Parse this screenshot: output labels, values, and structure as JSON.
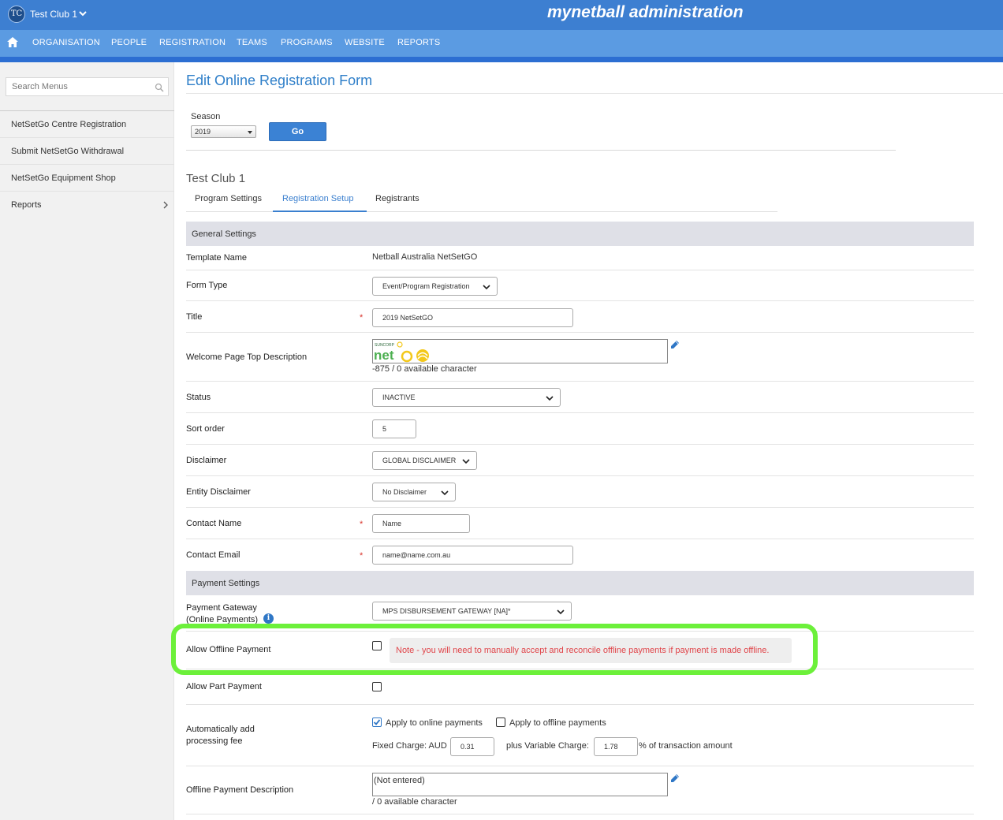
{
  "header": {
    "club_initials": "TC",
    "club_name": "Test Club 1",
    "brand": "mynetball administration"
  },
  "nav": {
    "items": [
      "ORGANISATION",
      "PEOPLE",
      "REGISTRATION",
      "TEAMS",
      "PROGRAMS",
      "WEBSITE",
      "REPORTS"
    ]
  },
  "sidebar": {
    "search_placeholder": "Search Menus",
    "items": [
      {
        "label": "NetSetGo Centre Registration"
      },
      {
        "label": "Submit NetSetGo Withdrawal"
      },
      {
        "label": "NetSetGo Equipment Shop"
      },
      {
        "label": "Reports"
      }
    ]
  },
  "page": {
    "title": "Edit Online Registration Form",
    "season_label": "Season",
    "season_value": "2019",
    "go_label": "Go",
    "club_heading": "Test Club 1",
    "tabs": [
      {
        "label": "Program Settings"
      },
      {
        "label": "Registration Setup"
      },
      {
        "label": "Registrants"
      }
    ]
  },
  "general": {
    "section": "General Settings",
    "template_name_label": "Template Name",
    "template_name_value": "Netball Australia NetSetGO",
    "form_type_label": "Form Type",
    "form_type_value": "Event/Program Registration",
    "title_label": "Title",
    "title_value": "2019 NetSetGO",
    "welcome_label": "Welcome Page Top Description",
    "welcome_chars": "-875 / 0 available character",
    "status_label": "Status",
    "status_value": "INACTIVE",
    "sort_label": "Sort order",
    "sort_value": "5",
    "disclaimer_label": "Disclaimer",
    "disclaimer_value": "GLOBAL DISCLAIMER",
    "entity_disclaimer_label": "Entity Disclaimer",
    "entity_disclaimer_value": "No Disclaimer",
    "contact_name_label": "Contact Name",
    "contact_name_value": "Name",
    "contact_email_label": "Contact Email",
    "contact_email_value": "name@name.com.au",
    "required_mark": "*"
  },
  "payment": {
    "section": "Payment Settings",
    "gateway_label_line1": "Payment Gateway",
    "gateway_label_line2": "(Online Payments)",
    "gateway_value": "MPS DISBURSEMENT GATEWAY [NA]*",
    "info_glyph": "i",
    "offline_label": "Allow Offline Payment",
    "offline_note": "Note - you will need to manually accept and reconcile offline payments if payment is made offline.",
    "part_label": "Allow Part Payment",
    "fee_label_line1": "Automatically add",
    "fee_label_line2": "processing fee",
    "apply_online": "Apply to online payments",
    "apply_offline": "Apply to offline payments",
    "fixed_charge_label": "Fixed Charge: AUD",
    "fixed_charge_value": "0.31",
    "variable_charge_label": "plus Variable Charge:",
    "variable_charge_value": "1.78",
    "variable_suffix": "% of transaction amount",
    "offline_desc_label": "Offline Payment Description",
    "offline_desc_value": "(Not entered)",
    "offline_desc_chars": "/ 0 available character"
  },
  "logo": {
    "brand_small": "SUNCORP",
    "brand_word": "net"
  },
  "colors": {
    "topbar": "#3d7fd1",
    "navbar": "#5b9be2",
    "accent": "#2f7fc9",
    "highlight": "#6cf03a",
    "note_text": "#e0454a"
  }
}
